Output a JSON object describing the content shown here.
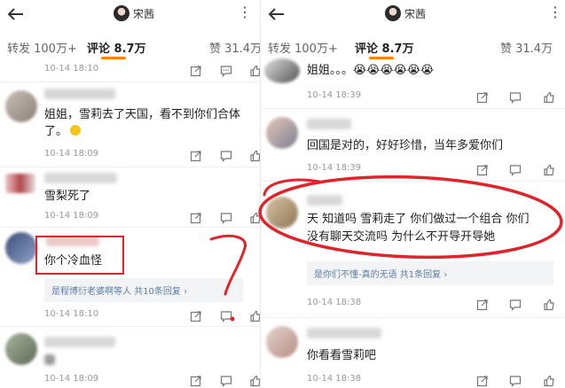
{
  "left": {
    "user_name": "宋茜",
    "tabs": {
      "repost": "转发 100万+",
      "comment": "评论 8.7万",
      "like": "赞 31.4万"
    },
    "comments": [
      {
        "text_lines": [],
        "time": "10-14 18:10"
      },
      {
        "text_lines": [
          "姐姐，雪莉去了天国，看不到你们合体",
          "了。"
        ],
        "time": "10-14 18:09"
      },
      {
        "text_lines": [
          "雪梨死了"
        ],
        "time": "10-14 18:09"
      },
      {
        "text_lines": [
          "你个冷血怪"
        ],
        "time": "10-14 18:10",
        "reply": "是程博衍老婆啊等人 共10条回复 ›"
      },
      {
        "text_lines": [],
        "time": "10-14 18:09"
      }
    ]
  },
  "right": {
    "user_name": "宋茜",
    "tabs": {
      "repost": "转发 100万+",
      "comment": "评论 8.7万",
      "like": "赞 31.4万"
    },
    "comments": [
      {
        "text_lines": [
          "姐姐。。。😭😭😭😭😭😭"
        ],
        "time": "10-14 18:39"
      },
      {
        "text_lines": [
          "回国是对的，好好珍惜，当年多爱你们"
        ],
        "time": "10-14 18:39"
      },
      {
        "text_lines": [
          "天 知道吗 雪莉走了 你们做过一个组合 你们",
          "没有聊天交流吗 为什么不开导开导她"
        ],
        "time": "10-14 18:38",
        "reply": "是你们不懂-真的无语 共1条回复 ›"
      },
      {
        "text_lines": [
          "你看看雪莉吧"
        ],
        "time": "10-14 18:38"
      }
    ]
  },
  "colors": {
    "accent": "#ff8200",
    "link": "#5c7ea8",
    "annotation_red": "#e0242c"
  },
  "icons": [
    "back-arrow-icon",
    "more-icon",
    "share-icon",
    "comment-icon",
    "like-icon",
    "emoji-icon"
  ]
}
